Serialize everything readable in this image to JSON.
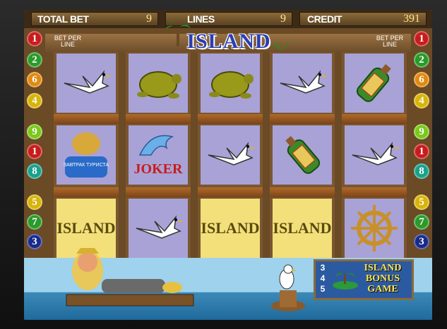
{
  "header": {
    "total_bet_label": "TOTAL BET",
    "total_bet_value": "9",
    "lines_label": "LINES",
    "lines_value": "9",
    "credit_label": "CREDIT",
    "credit_value": "391"
  },
  "logo": "ISLAND",
  "bet_per_line_left": "BET PER LINE",
  "bet_per_line_right": "BET PER LINE",
  "left_lines": [
    "1",
    "2",
    "6",
    "4",
    "9",
    "1",
    "8",
    "5",
    "7",
    "3"
  ],
  "right_lines": [
    "1",
    "2",
    "6",
    "4",
    "9",
    "1",
    "8",
    "5",
    "7",
    "3"
  ],
  "reels": [
    [
      "seagull",
      "can",
      "island"
    ],
    [
      "turtle",
      "joker",
      "seagull"
    ],
    [
      "turtle",
      "seagull",
      "island"
    ],
    [
      "seagull",
      "bottle",
      "island"
    ],
    [
      "bottle",
      "seagull",
      "wheel"
    ]
  ],
  "symbol_text": {
    "joker": "JOKER",
    "island": "ISLAND",
    "can": "ЗАВТРАК ТУРИСТА"
  },
  "bonus": {
    "numbers": [
      "3",
      "4",
      "5"
    ],
    "line1": "ISLAND",
    "line2": "BONUS",
    "line3": "GAME"
  },
  "colors": {
    "reel_cell": "#a8a2d6",
    "island_cell": "#f3e07a",
    "credit_value": "#ffe58a"
  }
}
